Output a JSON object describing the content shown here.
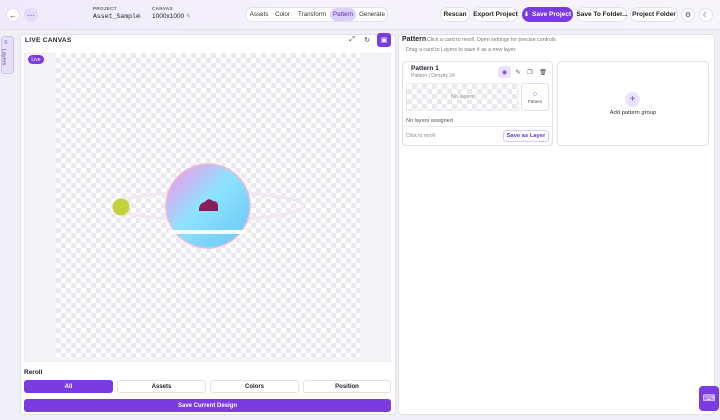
{
  "header": {
    "back_icon": "arrow-left-icon",
    "project_label": "PROJECT",
    "project_name": "Asset_Sample",
    "canvas_label": "CANVAS",
    "canvas_size": "1000x1000",
    "tabs": [
      {
        "label": "Assets",
        "active": false
      },
      {
        "label": "Color",
        "active": false
      },
      {
        "label": "Transform",
        "active": false
      },
      {
        "label": "Pattern",
        "active": true
      },
      {
        "label": "Generate",
        "active": false
      }
    ],
    "rescan": "Rescan",
    "export_project": "Export Project",
    "save_project": "Save Project",
    "save_to_folder": "Save To Folder...",
    "project_folder": "Project Folder",
    "accent_color": "#7a3be0"
  },
  "layers_tab": {
    "label": "Layers"
  },
  "canvas_panel": {
    "title": "LIVE CANVAS",
    "live_badge": "Live",
    "reroll_label": "Reroll",
    "reroll_options": [
      {
        "label": "All",
        "active": true
      },
      {
        "label": "Assets",
        "active": false
      },
      {
        "label": "Colors",
        "active": false
      },
      {
        "label": "Position",
        "active": false
      }
    ],
    "save_design": "Save Current Design"
  },
  "pattern_panel": {
    "title": "Pattern",
    "hint1": "Click a card to reroll. Open settings for precise controls.",
    "hint2": "Drag a card to Layers to save it as a new layer.",
    "card": {
      "name": "Pattern 1",
      "meta": "Pattern | Density 24",
      "preview_text": "No layers",
      "type_label": "Pattern",
      "assigned": "No layers assigned",
      "click_hint": "Click to reroll",
      "save_layer": "Save as Layer"
    },
    "add_group": "Add pattern group"
  }
}
